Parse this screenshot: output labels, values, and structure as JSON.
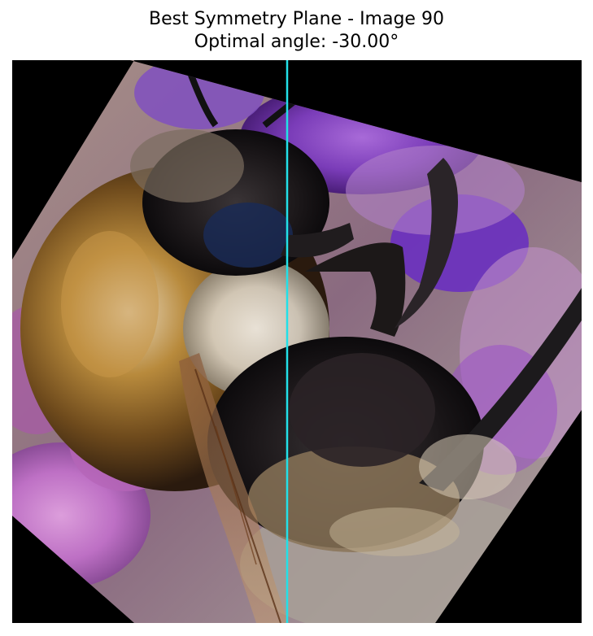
{
  "title": {
    "line1": "Best Symmetry Plane - Image 90",
    "line2": "Optimal angle: -30.00°"
  },
  "figure": {
    "rotation_degrees": -30.0,
    "symmetry_line_color": "#22e0e8",
    "background_color": "#000000",
    "subject": "bumblebee-on-purple-flower"
  }
}
